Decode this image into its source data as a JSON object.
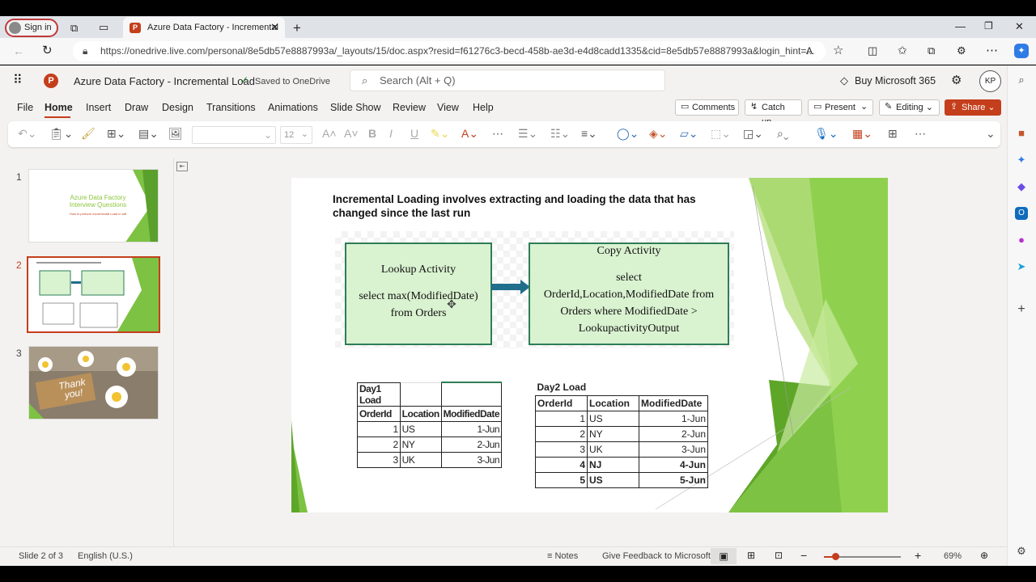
{
  "browser": {
    "signin": "Sign in",
    "tab_title": "Azure Data Factory - Incremental",
    "url": "https://onedrive.live.com/personal/8e5db57e8887993a/_layouts/15/doc.aspx?resid=f61276c3-becd-458b-ae3d-e4d8cadd1335&cid=8e5db57e8887993a&login_hint=..."
  },
  "header": {
    "doc_title": "Azure Data Factory - Incremental Load",
    "saved": "Saved to OneDrive",
    "search_placeholder": "Search (Alt + Q)",
    "buy": "Buy Microsoft 365",
    "avatar": "KP"
  },
  "menu": [
    "File",
    "Home",
    "Insert",
    "Draw",
    "Design",
    "Transitions",
    "Animations",
    "Slide Show",
    "Review",
    "View",
    "Help"
  ],
  "actions": {
    "comments": "Comments",
    "catchup": "Catch up",
    "present": "Present",
    "editing": "Editing",
    "share": "Share"
  },
  "ribbon": {
    "font_size": "12"
  },
  "thumbs": [
    {
      "num": "1",
      "title": "Azure Data Factory\nInterview Questions",
      "subtitle": "How to perform Incremental Load in adf"
    },
    {
      "num": "2"
    },
    {
      "num": "3",
      "text": "Thank\nyou!"
    }
  ],
  "slide": {
    "title": "Incremental Loading involves extracting and loading the data that has changed since the last run",
    "lookup": {
      "title": "Lookup Activity",
      "body": "select max(ModifiedDate) from Orders"
    },
    "copy": {
      "title": "Copy Activity",
      "body1": "select",
      "body2": "OrderId,Location,ModifiedDate from Orders where ModifiedDate > LookupactivityOutput"
    },
    "day1": {
      "label": "Day1 Load",
      "headers": [
        "OrderId",
        "Location",
        "ModifiedDate"
      ],
      "rows": [
        [
          "1",
          "US",
          "1-Jun"
        ],
        [
          "2",
          "NY",
          "2-Jun"
        ],
        [
          "3",
          "UK",
          "3-Jun"
        ]
      ]
    },
    "day2": {
      "label": "Day2 Load",
      "headers": [
        "OrderId",
        "Location",
        "ModifiedDate"
      ],
      "rows": [
        [
          "1",
          "US",
          "1-Jun"
        ],
        [
          "2",
          "NY",
          "2-Jun"
        ],
        [
          "3",
          "UK",
          "3-Jun"
        ],
        [
          "4",
          "NJ",
          "4-Jun"
        ],
        [
          "5",
          "US",
          "5-Jun"
        ]
      ]
    }
  },
  "status": {
    "slide": "Slide 2 of 3",
    "lang": "English (U.S.)",
    "notes": "Notes",
    "feedback": "Give Feedback to Microsoft",
    "zoom": "69%",
    "zoom_level": 0.45
  },
  "colors": {
    "accent": "#c43e1c",
    "green": "#7dc242",
    "box": "#d9f2d0"
  }
}
